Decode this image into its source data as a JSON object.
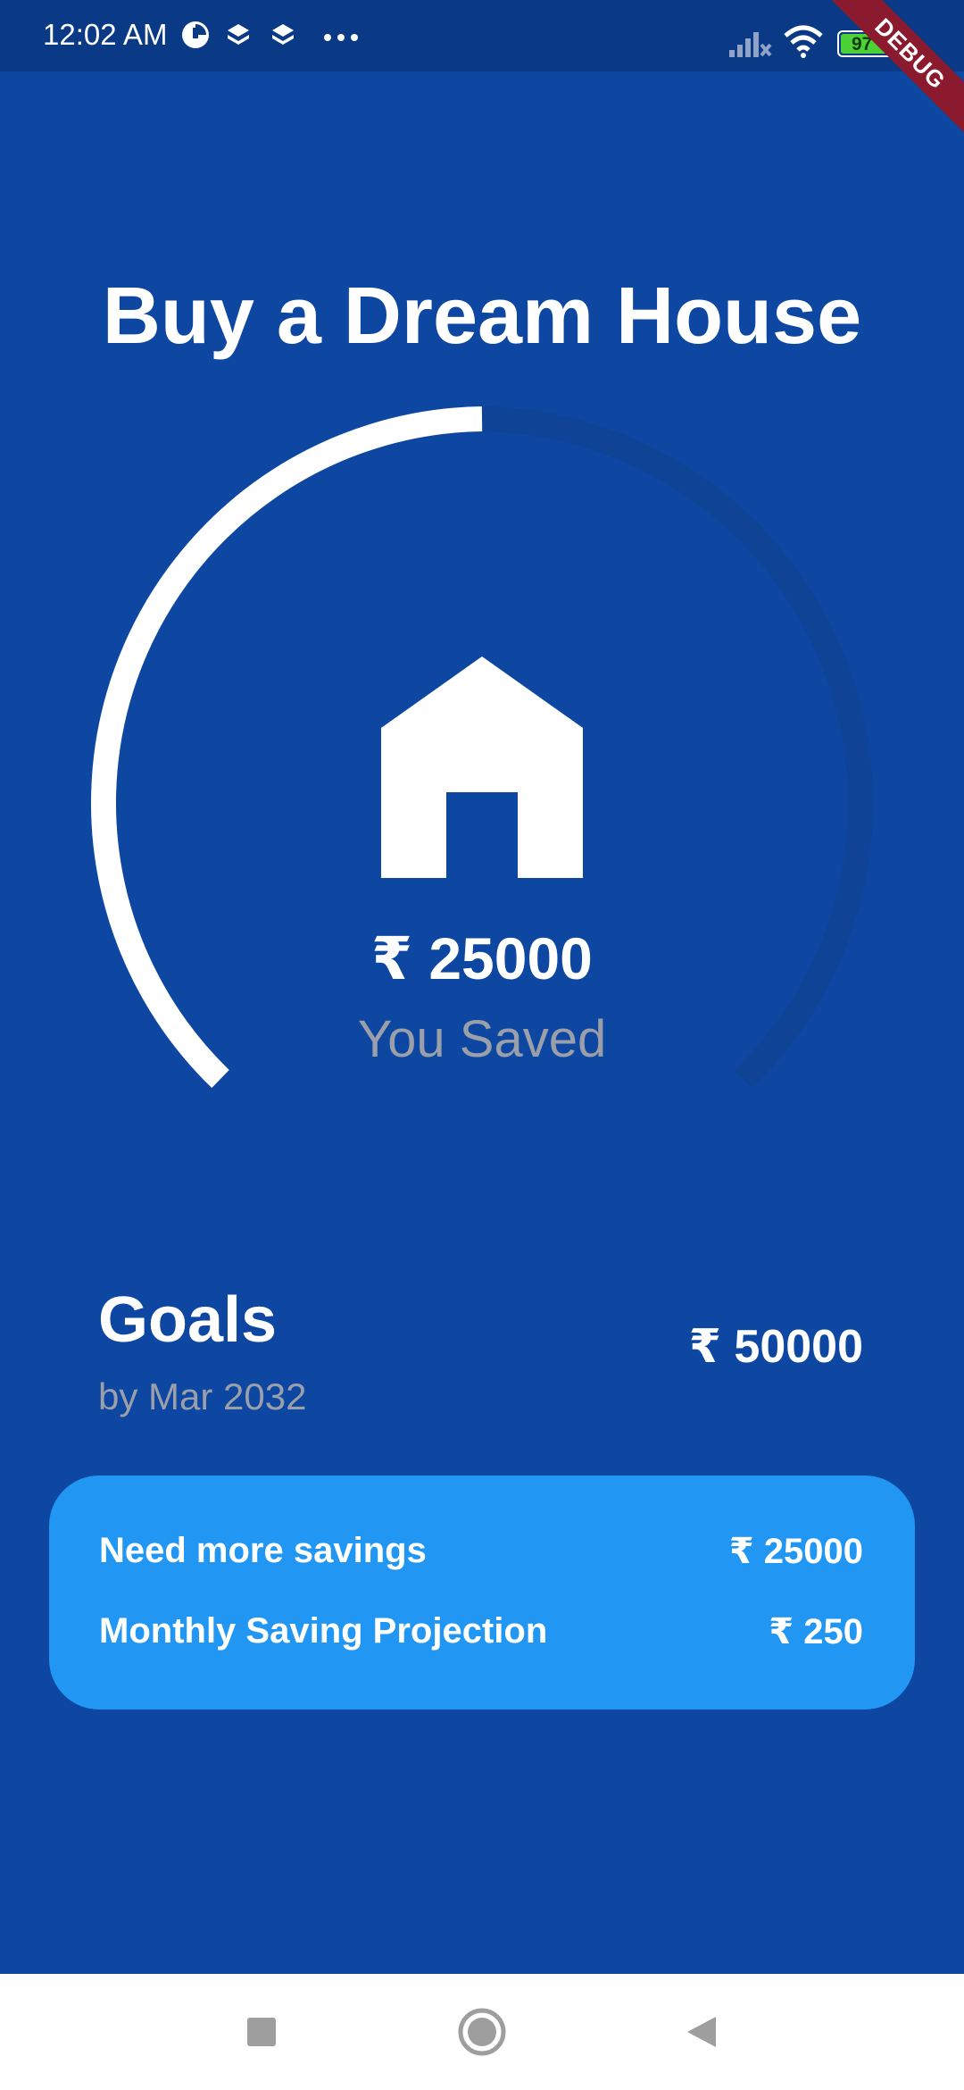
{
  "status_bar": {
    "time": "12:02 AM",
    "battery": "97",
    "debug_label": "DEBUG",
    "icons": [
      "pie-icon",
      "layers-icon",
      "layers-icon",
      "more-dots-icon",
      "signal-off-icon",
      "wifi-icon",
      "battery-icon"
    ]
  },
  "goal": {
    "title": "Buy a Dream House",
    "saved_amount": "₹ 25000",
    "saved_label": "You Saved",
    "progress": 0.5,
    "icon": "house-icon"
  },
  "goals_section": {
    "heading": "Goals",
    "date": "by Mar 2032",
    "target_amount": "₹ 50000"
  },
  "info_card": {
    "need_label": "Need more savings",
    "need_value": "₹ 25000",
    "monthly_label": "Monthly Saving Projection",
    "monthly_value": "₹ 250"
  },
  "nav": {
    "items": [
      "recents-button",
      "home-button",
      "back-button"
    ]
  },
  "colors": {
    "background": "#0D47A1",
    "status_bar": "#0A3A86",
    "card": "#2196F3",
    "muted_text": "#9A9FAA",
    "track": "#0E4396"
  }
}
